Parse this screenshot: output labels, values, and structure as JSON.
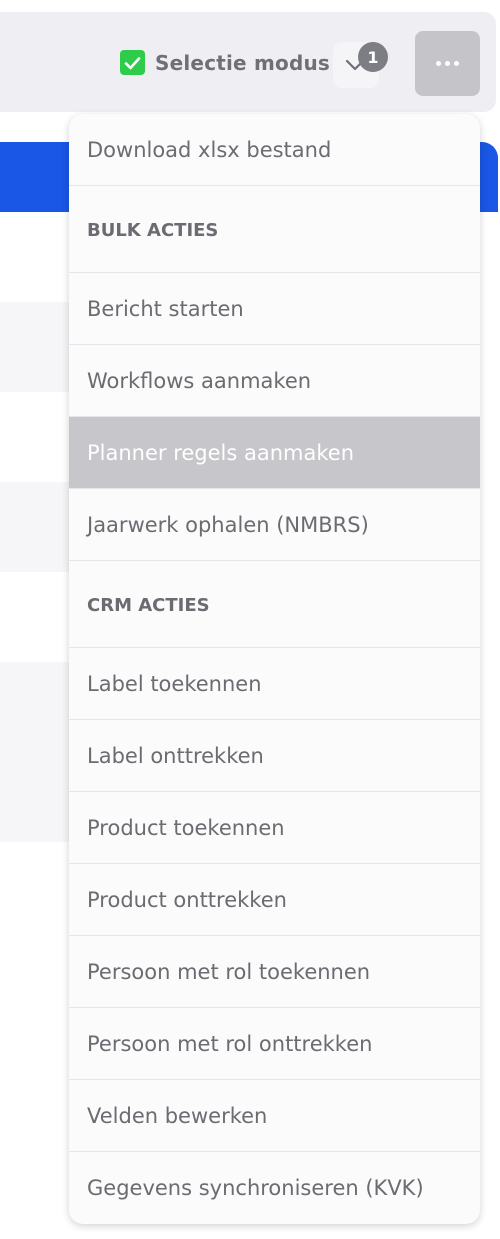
{
  "toolbar": {
    "selection_mode_label": "Selectie modus",
    "selection_mode_checked": true,
    "selected_count": "1",
    "colors": {
      "checkbox": "#2ecc4a",
      "accent_band": "#1a57e6",
      "more_button": "#c4c4c9"
    }
  },
  "menu": {
    "items": [
      {
        "label": "Download xlsx bestand",
        "type": "action"
      },
      {
        "label": "BULK ACTIES",
        "type": "header"
      },
      {
        "label": "Bericht starten",
        "type": "action"
      },
      {
        "label": "Workflows aanmaken",
        "type": "action"
      },
      {
        "label": "Planner regels aanmaken",
        "type": "action",
        "highlighted": true
      },
      {
        "label": "Jaarwerk ophalen (NMBRS)",
        "type": "action"
      },
      {
        "label": "CRM ACTIES",
        "type": "header"
      },
      {
        "label": "Label toekennen",
        "type": "action"
      },
      {
        "label": "Label onttrekken",
        "type": "action"
      },
      {
        "label": "Product toekennen",
        "type": "action"
      },
      {
        "label": "Product onttrekken",
        "type": "action"
      },
      {
        "label": "Persoon met rol toekennen",
        "type": "action"
      },
      {
        "label": "Persoon met rol onttrekken",
        "type": "action"
      },
      {
        "label": "Velden bewerken",
        "type": "action"
      },
      {
        "label": "Gegevens synchroniseren (KVK)",
        "type": "action"
      }
    ]
  }
}
